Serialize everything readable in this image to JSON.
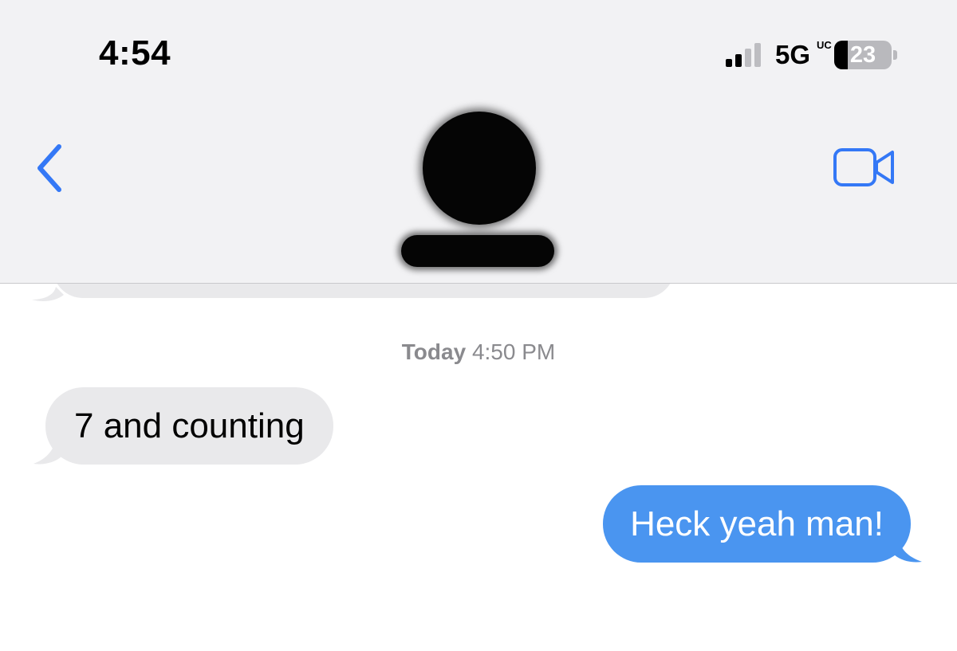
{
  "status_bar": {
    "time": "4:54",
    "network": "5G",
    "network_sup": "UC",
    "battery_level": 23,
    "battery_text": "23"
  },
  "header": {
    "back_icon": "chevron-left-icon",
    "contact_name": "",
    "video_icon": "video-camera-icon",
    "accent_color": "#3478f6"
  },
  "conversation": {
    "timestamp_day": "Today",
    "timestamp_time": "4:50 PM",
    "messages": [
      {
        "direction": "received",
        "text": "7 and counting"
      },
      {
        "direction": "sent",
        "text": "Heck yeah man!"
      }
    ]
  },
  "colors": {
    "received_bubble": "#e9e9eb",
    "sent_bubble": "#4a95f0",
    "header_background": "#f2f2f4",
    "timestamp_text": "#8a8a8e"
  }
}
